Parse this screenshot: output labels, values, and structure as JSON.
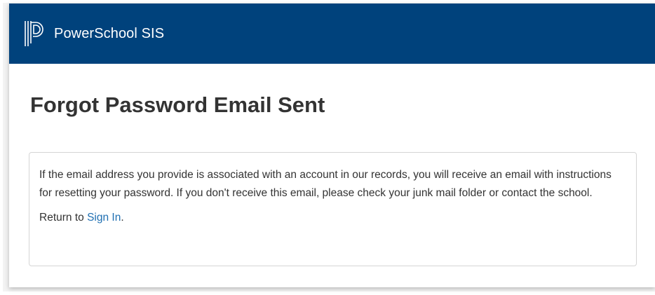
{
  "header": {
    "app_name": "PowerSchool SIS",
    "logo_icon": "powerschool-logo-icon",
    "background_color": "#00427c"
  },
  "main": {
    "title": "Forgot Password Email Sent",
    "message": "If the email address you provide is associated with an account in our records, you will receive an email with instructions for resetting your password. If you don't receive this email, please check your junk mail folder or contact the school.",
    "return_prefix": "Return to",
    "sign_in_link": "Sign In",
    "return_suffix": ".",
    "link_color": "#1f6fb2"
  }
}
